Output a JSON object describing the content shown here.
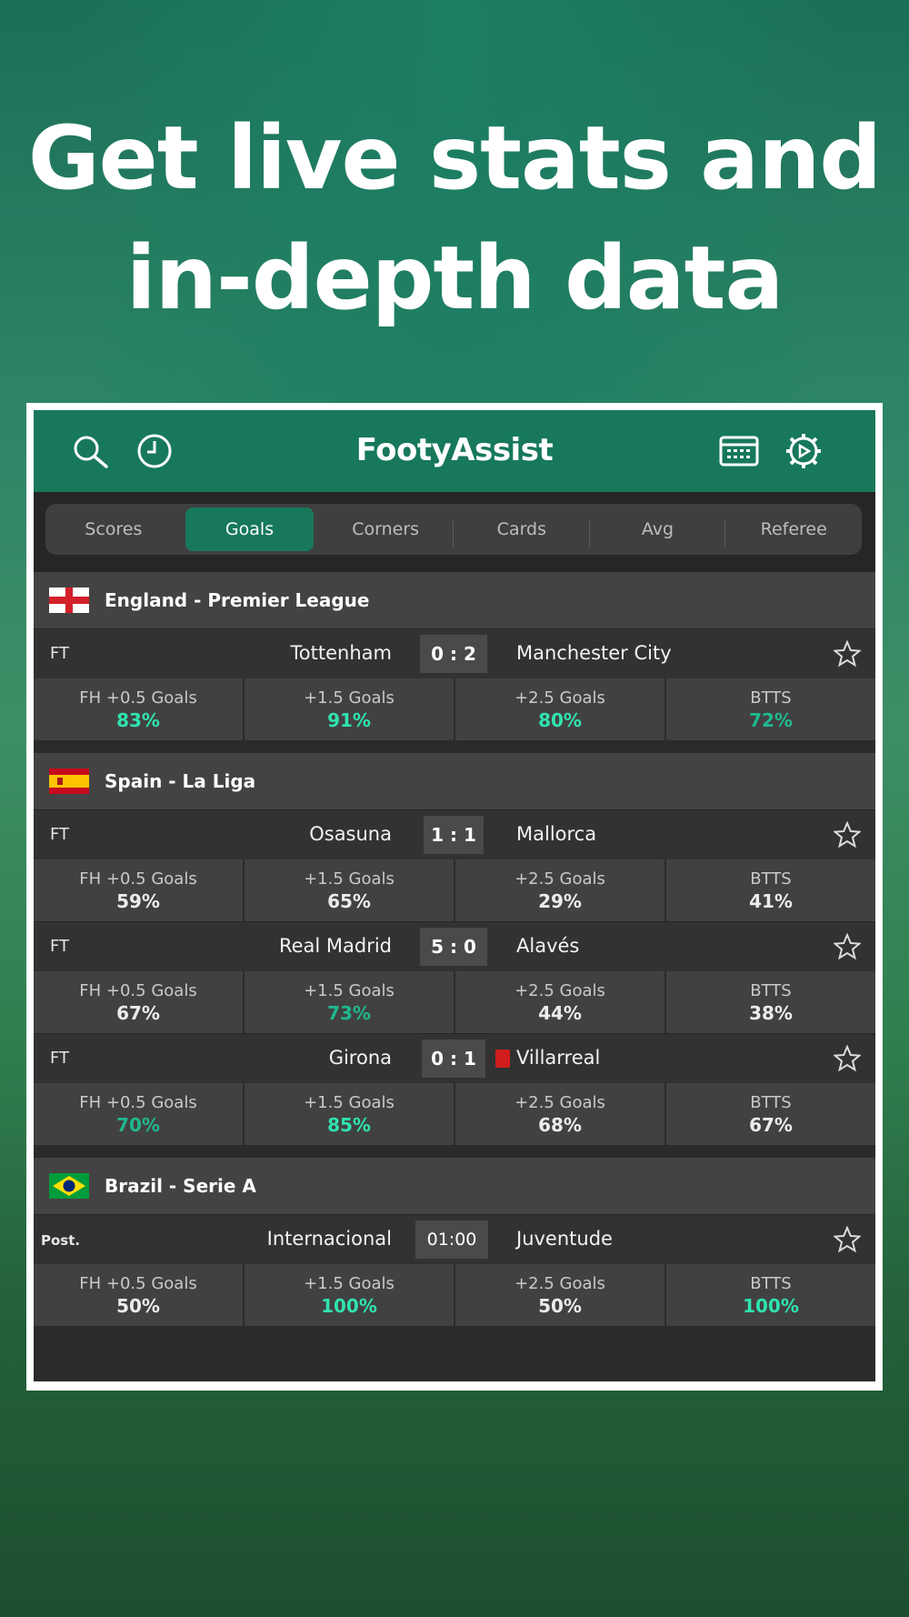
{
  "headline": {
    "line1": "Get live stats and",
    "line2": "in-depth data"
  },
  "app": {
    "title": "FootyAssist"
  },
  "colors": {
    "accent": "#17785c",
    "green_value": "#2fe3b0",
    "red_card": "#d11d1d"
  },
  "icons": {
    "search": "search-icon",
    "history": "clock-icon",
    "calendar": "calendar-icon",
    "settings": "settings-gear-icon",
    "favorite": "star-icon"
  },
  "tabs": [
    {
      "label": "Scores",
      "active": false
    },
    {
      "label": "Goals",
      "active": true
    },
    {
      "label": "Corners",
      "active": false
    },
    {
      "label": "Cards",
      "active": false
    },
    {
      "label": "Avg",
      "active": false
    },
    {
      "label": "Referee",
      "active": false
    }
  ],
  "leagues": [
    {
      "name": "England - Premier League",
      "flag": "england-flag",
      "matches": [
        {
          "status": "FT",
          "home": "Tottenham",
          "score": "0 : 2",
          "away": "Manchester City",
          "stats": [
            {
              "label": "FH +0.5 Goals",
              "value": "83%"
            },
            {
              "label": "+1.5 Goals",
              "value": "91%"
            },
            {
              "label": "+2.5 Goals",
              "value": "80%"
            },
            {
              "label": "BTTS",
              "value": "72%"
            }
          ]
        }
      ]
    },
    {
      "name": "Spain - La Liga",
      "flag": "spain-flag",
      "matches": [
        {
          "status": "FT",
          "home": "Osasuna",
          "score": "1 : 1",
          "away": "Mallorca",
          "stats": [
            {
              "label": "FH +0.5 Goals",
              "value": "59%"
            },
            {
              "label": "+1.5 Goals",
              "value": "65%"
            },
            {
              "label": "+2.5 Goals",
              "value": "29%"
            },
            {
              "label": "BTTS",
              "value": "41%"
            }
          ]
        },
        {
          "status": "FT",
          "home": "Real Madrid",
          "score": "5 : 0",
          "away": "Alavés",
          "stats": [
            {
              "label": "FH +0.5 Goals",
              "value": "67%"
            },
            {
              "label": "+1.5 Goals",
              "value": "73%"
            },
            {
              "label": "+2.5 Goals",
              "value": "44%"
            },
            {
              "label": "BTTS",
              "value": "38%"
            }
          ]
        },
        {
          "status": "FT",
          "home": "Girona",
          "score": "0 : 1",
          "away": "Villarreal",
          "away_red_card": true,
          "stats": [
            {
              "label": "FH +0.5 Goals",
              "value": "70%"
            },
            {
              "label": "+1.5 Goals",
              "value": "85%"
            },
            {
              "label": "+2.5 Goals",
              "value": "68%"
            },
            {
              "label": "BTTS",
              "value": "67%"
            }
          ]
        }
      ]
    },
    {
      "name": "Brazil - Serie A",
      "flag": "brazil-flag",
      "matches": [
        {
          "status": "Post.",
          "home": "Internacional",
          "score": "01:00",
          "away": "Juventude",
          "stats": [
            {
              "label": "FH +0.5 Goals",
              "value": "50%"
            },
            {
              "label": "+1.5 Goals",
              "value": "100%"
            },
            {
              "label": "+2.5 Goals",
              "value": "50%"
            },
            {
              "label": "BTTS",
              "value": "100%"
            }
          ]
        }
      ]
    }
  ]
}
